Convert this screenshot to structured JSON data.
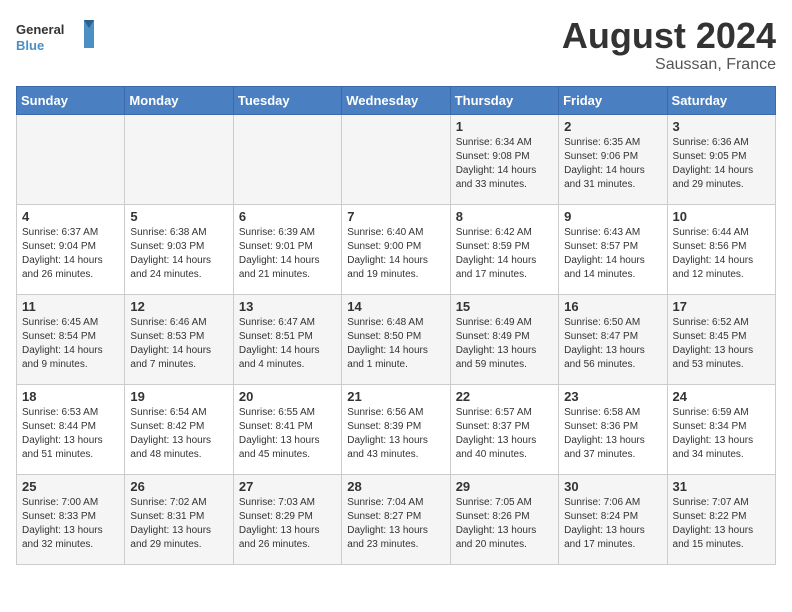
{
  "header": {
    "logo": {
      "general": "General",
      "blue": "Blue"
    },
    "title": "August 2024",
    "subtitle": "Saussan, France"
  },
  "weekdays": [
    "Sunday",
    "Monday",
    "Tuesday",
    "Wednesday",
    "Thursday",
    "Friday",
    "Saturday"
  ],
  "weeks": [
    [
      {
        "day": "",
        "sunrise": "",
        "sunset": "",
        "daylight": ""
      },
      {
        "day": "",
        "sunrise": "",
        "sunset": "",
        "daylight": ""
      },
      {
        "day": "",
        "sunrise": "",
        "sunset": "",
        "daylight": ""
      },
      {
        "day": "",
        "sunrise": "",
        "sunset": "",
        "daylight": ""
      },
      {
        "day": "1",
        "sunrise": "Sunrise: 6:34 AM",
        "sunset": "Sunset: 9:08 PM",
        "daylight": "Daylight: 14 hours and 33 minutes."
      },
      {
        "day": "2",
        "sunrise": "Sunrise: 6:35 AM",
        "sunset": "Sunset: 9:06 PM",
        "daylight": "Daylight: 14 hours and 31 minutes."
      },
      {
        "day": "3",
        "sunrise": "Sunrise: 6:36 AM",
        "sunset": "Sunset: 9:05 PM",
        "daylight": "Daylight: 14 hours and 29 minutes."
      }
    ],
    [
      {
        "day": "4",
        "sunrise": "Sunrise: 6:37 AM",
        "sunset": "Sunset: 9:04 PM",
        "daylight": "Daylight: 14 hours and 26 minutes."
      },
      {
        "day": "5",
        "sunrise": "Sunrise: 6:38 AM",
        "sunset": "Sunset: 9:03 PM",
        "daylight": "Daylight: 14 hours and 24 minutes."
      },
      {
        "day": "6",
        "sunrise": "Sunrise: 6:39 AM",
        "sunset": "Sunset: 9:01 PM",
        "daylight": "Daylight: 14 hours and 21 minutes."
      },
      {
        "day": "7",
        "sunrise": "Sunrise: 6:40 AM",
        "sunset": "Sunset: 9:00 PM",
        "daylight": "Daylight: 14 hours and 19 minutes."
      },
      {
        "day": "8",
        "sunrise": "Sunrise: 6:42 AM",
        "sunset": "Sunset: 8:59 PM",
        "daylight": "Daylight: 14 hours and 17 minutes."
      },
      {
        "day": "9",
        "sunrise": "Sunrise: 6:43 AM",
        "sunset": "Sunset: 8:57 PM",
        "daylight": "Daylight: 14 hours and 14 minutes."
      },
      {
        "day": "10",
        "sunrise": "Sunrise: 6:44 AM",
        "sunset": "Sunset: 8:56 PM",
        "daylight": "Daylight: 14 hours and 12 minutes."
      }
    ],
    [
      {
        "day": "11",
        "sunrise": "Sunrise: 6:45 AM",
        "sunset": "Sunset: 8:54 PM",
        "daylight": "Daylight: 14 hours and 9 minutes."
      },
      {
        "day": "12",
        "sunrise": "Sunrise: 6:46 AM",
        "sunset": "Sunset: 8:53 PM",
        "daylight": "Daylight: 14 hours and 7 minutes."
      },
      {
        "day": "13",
        "sunrise": "Sunrise: 6:47 AM",
        "sunset": "Sunset: 8:51 PM",
        "daylight": "Daylight: 14 hours and 4 minutes."
      },
      {
        "day": "14",
        "sunrise": "Sunrise: 6:48 AM",
        "sunset": "Sunset: 8:50 PM",
        "daylight": "Daylight: 14 hours and 1 minute."
      },
      {
        "day": "15",
        "sunrise": "Sunrise: 6:49 AM",
        "sunset": "Sunset: 8:49 PM",
        "daylight": "Daylight: 13 hours and 59 minutes."
      },
      {
        "day": "16",
        "sunrise": "Sunrise: 6:50 AM",
        "sunset": "Sunset: 8:47 PM",
        "daylight": "Daylight: 13 hours and 56 minutes."
      },
      {
        "day": "17",
        "sunrise": "Sunrise: 6:52 AM",
        "sunset": "Sunset: 8:45 PM",
        "daylight": "Daylight: 13 hours and 53 minutes."
      }
    ],
    [
      {
        "day": "18",
        "sunrise": "Sunrise: 6:53 AM",
        "sunset": "Sunset: 8:44 PM",
        "daylight": "Daylight: 13 hours and 51 minutes."
      },
      {
        "day": "19",
        "sunrise": "Sunrise: 6:54 AM",
        "sunset": "Sunset: 8:42 PM",
        "daylight": "Daylight: 13 hours and 48 minutes."
      },
      {
        "day": "20",
        "sunrise": "Sunrise: 6:55 AM",
        "sunset": "Sunset: 8:41 PM",
        "daylight": "Daylight: 13 hours and 45 minutes."
      },
      {
        "day": "21",
        "sunrise": "Sunrise: 6:56 AM",
        "sunset": "Sunset: 8:39 PM",
        "daylight": "Daylight: 13 hours and 43 minutes."
      },
      {
        "day": "22",
        "sunrise": "Sunrise: 6:57 AM",
        "sunset": "Sunset: 8:37 PM",
        "daylight": "Daylight: 13 hours and 40 minutes."
      },
      {
        "day": "23",
        "sunrise": "Sunrise: 6:58 AM",
        "sunset": "Sunset: 8:36 PM",
        "daylight": "Daylight: 13 hours and 37 minutes."
      },
      {
        "day": "24",
        "sunrise": "Sunrise: 6:59 AM",
        "sunset": "Sunset: 8:34 PM",
        "daylight": "Daylight: 13 hours and 34 minutes."
      }
    ],
    [
      {
        "day": "25",
        "sunrise": "Sunrise: 7:00 AM",
        "sunset": "Sunset: 8:33 PM",
        "daylight": "Daylight: 13 hours and 32 minutes."
      },
      {
        "day": "26",
        "sunrise": "Sunrise: 7:02 AM",
        "sunset": "Sunset: 8:31 PM",
        "daylight": "Daylight: 13 hours and 29 minutes."
      },
      {
        "day": "27",
        "sunrise": "Sunrise: 7:03 AM",
        "sunset": "Sunset: 8:29 PM",
        "daylight": "Daylight: 13 hours and 26 minutes."
      },
      {
        "day": "28",
        "sunrise": "Sunrise: 7:04 AM",
        "sunset": "Sunset: 8:27 PM",
        "daylight": "Daylight: 13 hours and 23 minutes."
      },
      {
        "day": "29",
        "sunrise": "Sunrise: 7:05 AM",
        "sunset": "Sunset: 8:26 PM",
        "daylight": "Daylight: 13 hours and 20 minutes."
      },
      {
        "day": "30",
        "sunrise": "Sunrise: 7:06 AM",
        "sunset": "Sunset: 8:24 PM",
        "daylight": "Daylight: 13 hours and 17 minutes."
      },
      {
        "day": "31",
        "sunrise": "Sunrise: 7:07 AM",
        "sunset": "Sunset: 8:22 PM",
        "daylight": "Daylight: 13 hours and 15 minutes."
      }
    ]
  ]
}
